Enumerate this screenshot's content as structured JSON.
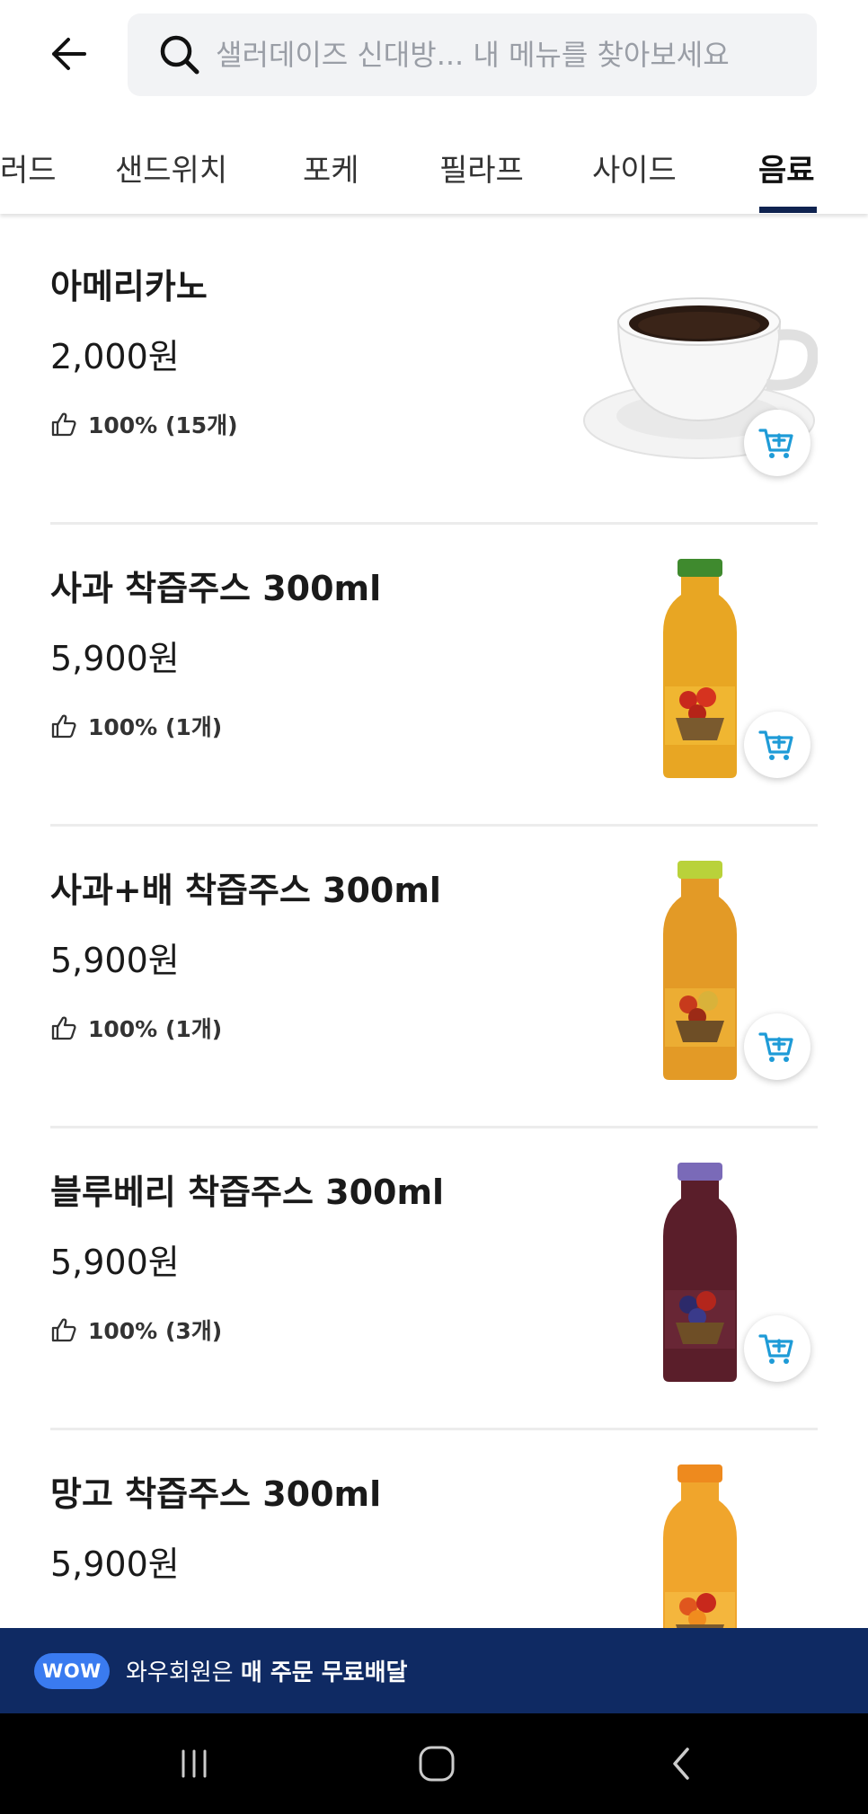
{
  "search": {
    "placeholder": "샐러데이즈 신대방... 내 메뉴를 찾아보세요"
  },
  "icons": {
    "back": "arrow-left-icon",
    "search": "search-icon",
    "like": "thumbs-up-icon",
    "cart": "cart-plus-icon"
  },
  "tabs": [
    {
      "label": "러드"
    },
    {
      "label": "샌드위치"
    },
    {
      "label": "포케"
    },
    {
      "label": "필라프"
    },
    {
      "label": "사이드"
    },
    {
      "label": "음료",
      "active": true
    }
  ],
  "menu": {
    "items": [
      {
        "name": "아메리카노",
        "price": "2,000원",
        "rating": "100% (15개)"
      },
      {
        "name": "사과 착즙주스 300ml",
        "price": "5,900원",
        "rating": "100% (1개)"
      },
      {
        "name": "사과+배 착즙주스 300ml",
        "price": "5,900원",
        "rating": "100% (1개)"
      },
      {
        "name": "블루베리 착즙주스 300ml",
        "price": "5,900원",
        "rating": "100% (3개)"
      },
      {
        "name": "망고 착즙주스 300ml",
        "price": "5,900원"
      }
    ]
  },
  "promo": {
    "badge": "WOW",
    "text_prefix": "와우회원은 ",
    "text_bold": "매 주문 무료배달"
  },
  "colors": {
    "accent_navy": "#0f2350",
    "promo_bg": "#0f2a63",
    "wow_badge": "#3a7bf0",
    "cart_icon": "#1e9bd7"
  }
}
